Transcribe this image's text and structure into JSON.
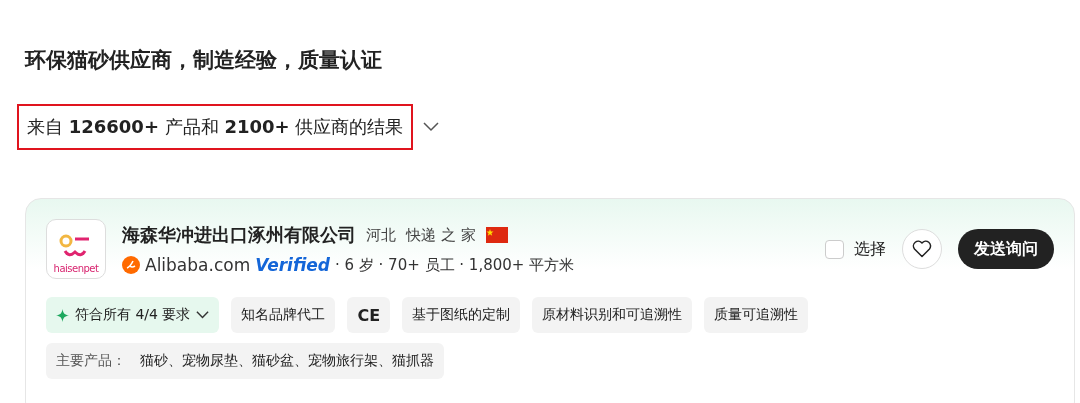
{
  "heading": "环保猫砂供应商，制造经验，质量认证",
  "results": {
    "text": "来自 **126600+** 产品和 **2100+** 供应商的结果",
    "highlighted": true,
    "expanded": false
  },
  "supplier": {
    "logo_text": "haisenpet",
    "name": "海森华冲进出口涿州有限公司",
    "region": "河北",
    "tagline": "快递 之 家",
    "platform": "Alibaba.com",
    "verified": "Verified",
    "facts": "· 6 岁 · 70+ 员工 · 1,800+ 平方米",
    "select": {
      "label": "选择",
      "checked": false
    },
    "favorite": false,
    "inquiry_button": "发送询问",
    "tags": [
      {
        "kind": "match",
        "label": "符合所有 4/4 要求"
      },
      {
        "kind": "tag",
        "label": "知名品牌代工"
      },
      {
        "kind": "cert",
        "label": "CE"
      },
      {
        "kind": "tag",
        "label": "基于图纸的定制"
      },
      {
        "kind": "tag",
        "label": "原材料识别和可追溯性"
      },
      {
        "kind": "tag",
        "label": "质量可追溯性"
      }
    ],
    "main_products": {
      "label": "主要产品：",
      "value": "猫砂、宠物尿垫、猫砂盆、宠物旅行架、猫抓器"
    }
  }
}
